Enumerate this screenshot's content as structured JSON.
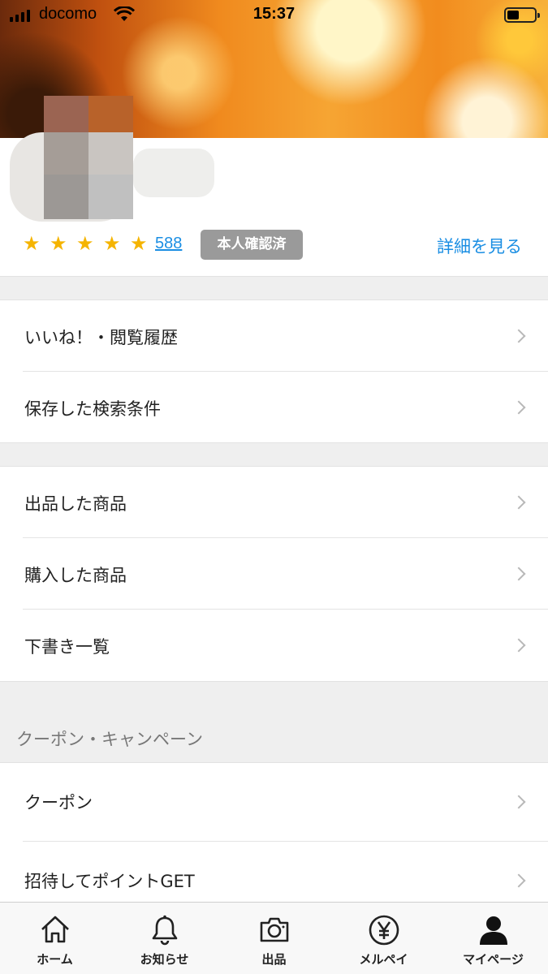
{
  "status_bar": {
    "carrier": "docomo",
    "time": "15:37"
  },
  "profile": {
    "rating_stars": 5,
    "review_count": "588",
    "verified_badge": "本人確認済",
    "details_link": "詳細を見る"
  },
  "menu_group_1": [
    {
      "label": "いいね！・閲覧履歴"
    },
    {
      "label": "保存した検索条件"
    }
  ],
  "menu_group_2": [
    {
      "label": "出品した商品"
    },
    {
      "label": "購入した商品"
    },
    {
      "label": "下書き一覧"
    }
  ],
  "coupon_section": {
    "title": "クーポン・キャンペーン",
    "items": [
      {
        "label": "クーポン"
      },
      {
        "label": "招待してポイントGET"
      }
    ]
  },
  "tabbar": {
    "tabs": [
      {
        "label": "ホーム",
        "icon": "home-icon"
      },
      {
        "label": "お知らせ",
        "icon": "bell-icon"
      },
      {
        "label": "出品",
        "icon": "camera-icon"
      },
      {
        "label": "メルペイ",
        "icon": "yen-icon"
      },
      {
        "label": "マイページ",
        "icon": "person-icon"
      }
    ]
  },
  "colors": {
    "link": "#1a8ee3",
    "star": "#f5b400",
    "badge": "#9a9a9a"
  }
}
